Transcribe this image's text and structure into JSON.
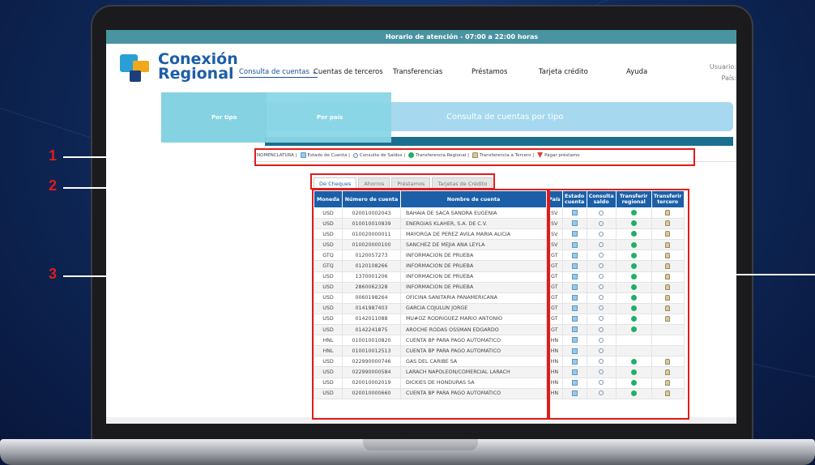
{
  "topbar": {
    "hours": "Horario de atención - 07:00 a 22:00 horas"
  },
  "logo": {
    "line1": "Conexión",
    "line2": "Regional"
  },
  "nav": [
    {
      "label": "Consulta de cuentas ⌄"
    },
    {
      "label": "Cuentas de terceros"
    },
    {
      "label": "Transferencias"
    },
    {
      "label": "Préstamos"
    },
    {
      "label": "Tarjeta crédito"
    },
    {
      "label": "Ayuda"
    }
  ],
  "user": {
    "usuario": "Usuario:",
    "pais": "País:"
  },
  "submenu": {
    "por_tipo": "Por tipo",
    "por_pais": "Por país"
  },
  "banner": {
    "title": "Consulta de cuentas por tipo"
  },
  "legend": {
    "label": "NOMENCLATURA |",
    "items": [
      {
        "label": "Estado de Cuenta |",
        "icon": "document-icon"
      },
      {
        "label": "Consulta de Saldos |",
        "icon": "magnifier-icon"
      },
      {
        "label": "Transferencia Regional |",
        "icon": "transfer-icon"
      },
      {
        "label": "Transferencia a Tercero |",
        "icon": "person-icon"
      },
      {
        "label": "Pagar préstamo",
        "icon": "pay-icon"
      }
    ]
  },
  "tabs": [
    "De Cheques",
    "Ahorros",
    "Préstamos",
    "Tarjetas de Crédito"
  ],
  "table": {
    "headers": [
      "Moneda",
      "Número de cuenta",
      "Nombre de cuenta",
      "País",
      "Estado cuenta",
      "Consulta saldo",
      "Transferir regional",
      "Transferir tercero"
    ],
    "rows": [
      {
        "moneda": "USD",
        "numero": "020010002043",
        "nombre": "BAHAIA DE SACA SANDRA EUGENIA",
        "pais": "SV",
        "tr": true,
        "tt": true
      },
      {
        "moneda": "USD",
        "numero": "010010010839",
        "nombre": "ENERGIAS KLAHER, S.A. DE C.V.",
        "pais": "SV",
        "tr": true,
        "tt": true
      },
      {
        "moneda": "USD",
        "numero": "010020000011",
        "nombre": "MAYORGA DE PEREZ AVILA MARIA ALICIA",
        "pais": "SV",
        "tr": true,
        "tt": true
      },
      {
        "moneda": "USD",
        "numero": "010020000100",
        "nombre": "SANCHEZ DE MEJIA ANA LEYLA",
        "pais": "SV",
        "tr": true,
        "tt": true
      },
      {
        "moneda": "GTQ",
        "numero": "0120057273",
        "nombre": "INFORMACION DE PRUEBA",
        "pais": "GT",
        "tr": true,
        "tt": true
      },
      {
        "moneda": "GTQ",
        "numero": "0120108266",
        "nombre": "INFORMACION DE PRUEBA",
        "pais": "GT",
        "tr": true,
        "tt": true
      },
      {
        "moneda": "USD",
        "numero": "1370001206",
        "nombre": "INFORMACION DE PRUEBA",
        "pais": "GT",
        "tr": true,
        "tt": true
      },
      {
        "moneda": "USD",
        "numero": "2860062328",
        "nombre": "INFORMACION DE PRUEBA",
        "pais": "GT",
        "tr": true,
        "tt": true
      },
      {
        "moneda": "USD",
        "numero": "0060198264",
        "nombre": "OFICINA SANITARIA PANAMERICANA",
        "pais": "GT",
        "tr": true,
        "tt": true
      },
      {
        "moneda": "USD",
        "numero": "0141987403",
        "nombre": "GARCIA COJULUN JORGE",
        "pais": "GT",
        "tr": true,
        "tt": true
      },
      {
        "moneda": "USD",
        "numero": "0142011088",
        "nombre": "MU#OZ RODRIGUEZ MARIO ANTONIO",
        "pais": "GT",
        "tr": true,
        "tt": true
      },
      {
        "moneda": "USD",
        "numero": "0142241875",
        "nombre": "AROCHE RODAS OSSMAN EDGARDO",
        "pais": "GT",
        "tr": true,
        "tt": false
      },
      {
        "moneda": "HNL",
        "numero": "010010010820",
        "nombre": "CUENTA BP PARA PAGO AUTOMATICO",
        "pais": "HN",
        "tr": false,
        "tt": false
      },
      {
        "moneda": "HNL",
        "numero": "010010012513",
        "nombre": "CUENTA BP PARA PAGO AUTOMATICO",
        "pais": "HN",
        "tr": false,
        "tt": false
      },
      {
        "moneda": "USD",
        "numero": "022990000746",
        "nombre": "GAS DEL CARIBE SA",
        "pais": "HN",
        "tr": true,
        "tt": true
      },
      {
        "moneda": "USD",
        "numero": "022990000584",
        "nombre": "LARACH NAPOLEON/COMERCIAL LARACH",
        "pais": "HN",
        "tr": true,
        "tt": true
      },
      {
        "moneda": "USD",
        "numero": "020010002019",
        "nombre": "DICKIES DE HONDURAS SA",
        "pais": "HN",
        "tr": true,
        "tt": true
      },
      {
        "moneda": "USD",
        "numero": "020010000660",
        "nombre": "CUENTA BP PARA PAGO AUTOMATICO",
        "pais": "HN",
        "tr": true,
        "tt": true
      }
    ]
  },
  "callouts": [
    "1",
    "2",
    "3"
  ],
  "colors": {
    "accent": "#1b5fa8",
    "topbar": "#4a93a1",
    "callout": "#e11b1b"
  }
}
